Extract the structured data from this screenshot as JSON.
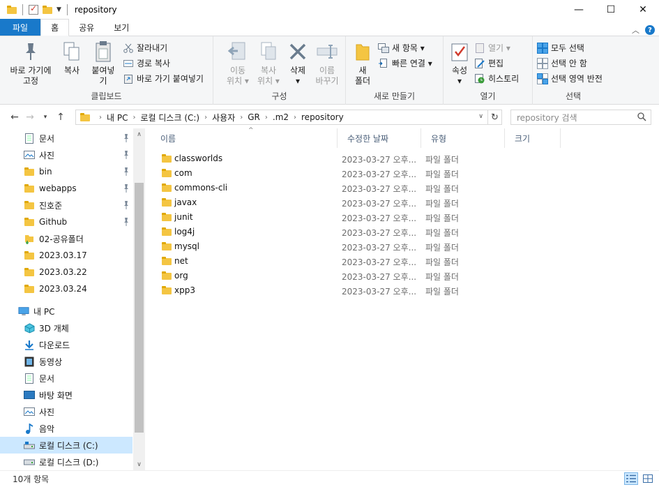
{
  "window": {
    "title": "repository",
    "minimize": "—",
    "maximize": "☐",
    "close": "✕"
  },
  "tabs": [
    {
      "label": "파일"
    },
    {
      "label": "홈"
    },
    {
      "label": "공유"
    },
    {
      "label": "보기"
    }
  ],
  "ribbon": {
    "clipboard": {
      "label": "클립보드",
      "pin_quick": "바로 가기에\n고정",
      "copy": "복사",
      "paste": "붙여넣기",
      "cut": "잘라내기",
      "copy_path": "경로 복사",
      "paste_shortcut": "바로 가기 붙여넣기"
    },
    "organize": {
      "label": "구성",
      "move_to": "이동\n위치 ▾",
      "copy_to": "복사\n위치 ▾",
      "delete": "삭제\n▾",
      "rename": "이름\n바꾸기"
    },
    "new": {
      "label": "새로 만들기",
      "new_folder": "새\n폴더",
      "new_item": "새 항목 ▾",
      "easy_access": "빠른 연결 ▾"
    },
    "open": {
      "label": "열기",
      "properties": "속성\n▾",
      "open": "열기 ▾",
      "edit": "편집",
      "history": "히스토리"
    },
    "select": {
      "label": "선택",
      "select_all": "모두 선택",
      "select_none": "선택 안 함",
      "invert": "선택 영역 반전"
    }
  },
  "address": {
    "crumbs": [
      "내 PC",
      "로컬 디스크 (C:)",
      "사용자",
      "GR",
      ".m2",
      "repository"
    ],
    "search_placeholder": "repository 검색"
  },
  "nav": {
    "quick": [
      {
        "label": "문서",
        "pinned": true,
        "icon": "document-icon"
      },
      {
        "label": "사진",
        "pinned": true,
        "icon": "picture-icon"
      },
      {
        "label": "bin",
        "pinned": true,
        "icon": "folder-icon"
      },
      {
        "label": "webapps",
        "pinned": true,
        "icon": "folder-icon"
      },
      {
        "label": "진호준",
        "pinned": true,
        "icon": "folder-icon"
      },
      {
        "label": "Github",
        "pinned": true,
        "icon": "folder-icon"
      },
      {
        "label": "02-공유폴더",
        "pinned": false,
        "icon": "shared-folder-icon"
      },
      {
        "label": "2023.03.17",
        "pinned": false,
        "icon": "folder-icon"
      },
      {
        "label": "2023.03.22",
        "pinned": false,
        "icon": "folder-icon"
      },
      {
        "label": "2023.03.24",
        "pinned": false,
        "icon": "folder-icon"
      }
    ],
    "pc": {
      "label": "내 PC"
    },
    "pc_items": [
      {
        "label": "3D 개체",
        "icon": "3d-objects-icon"
      },
      {
        "label": "다운로드",
        "icon": "download-icon"
      },
      {
        "label": "동영상",
        "icon": "video-icon"
      },
      {
        "label": "문서",
        "icon": "document-icon"
      },
      {
        "label": "바탕 화면",
        "icon": "desktop-icon"
      },
      {
        "label": "사진",
        "icon": "picture-icon"
      },
      {
        "label": "음악",
        "icon": "music-icon"
      },
      {
        "label": "로컬 디스크 (C:)",
        "icon": "drive-icon",
        "selected": true
      },
      {
        "label": "로컬 디스크 (D:)",
        "icon": "drive-icon"
      }
    ]
  },
  "columns": {
    "name": "이름",
    "date": "수정한 날짜",
    "type": "유형",
    "size": "크기"
  },
  "files": [
    {
      "name": "classworlds",
      "date": "2023-03-27 오후...",
      "type": "파일 폴더"
    },
    {
      "name": "com",
      "date": "2023-03-27 오후...",
      "type": "파일 폴더"
    },
    {
      "name": "commons-cli",
      "date": "2023-03-27 오후...",
      "type": "파일 폴더"
    },
    {
      "name": "javax",
      "date": "2023-03-27 오후...",
      "type": "파일 폴더"
    },
    {
      "name": "junit",
      "date": "2023-03-27 오후...",
      "type": "파일 폴더"
    },
    {
      "name": "log4j",
      "date": "2023-03-27 오후...",
      "type": "파일 폴더"
    },
    {
      "name": "mysql",
      "date": "2023-03-27 오후...",
      "type": "파일 폴더"
    },
    {
      "name": "net",
      "date": "2023-03-27 오후...",
      "type": "파일 폴더"
    },
    {
      "name": "org",
      "date": "2023-03-27 오후...",
      "type": "파일 폴더"
    },
    {
      "name": "xpp3",
      "date": "2023-03-27 오후...",
      "type": "파일 폴더"
    }
  ],
  "status": {
    "count": "10개 항목"
  },
  "colors": {
    "accent": "#1979ca",
    "folder": "#f4c542",
    "selection": "#cce8ff"
  }
}
